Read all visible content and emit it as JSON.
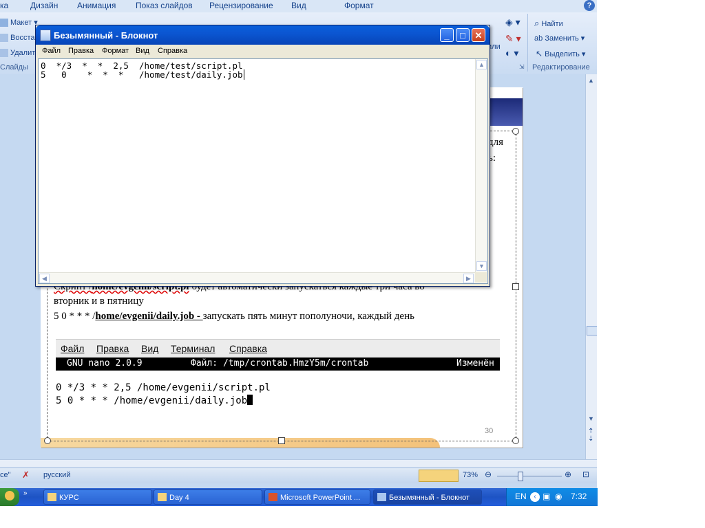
{
  "powerpoint": {
    "ribbon_tabs": [
      "ка",
      "Дизайн",
      "Анимация",
      "Показ слайдов",
      "Рецензирование",
      "Вид",
      "Формат"
    ],
    "slides_group": {
      "maket": "Макет",
      "restore": "Восстан",
      "delete": "Удалит",
      "label": "Слайды"
    },
    "partial_label": "или",
    "editing_group": {
      "find": "Найти",
      "replace": "Заменить",
      "select": "Выделить",
      "label": "Редактирование"
    },
    "slide": {
      "partial_right_1": "для",
      "partial_right_2": "ь:",
      "text_line1_prefix": "Скрипт /",
      "text_line1_bold": "home/evgenii/script.pl",
      "text_line1_rest": " будет автоматически запускаться каждые три часа во",
      "text_line2": "вторник и в пятницу",
      "text_line3_prefix": "5 0 * * * /",
      "text_line3_bold": "home/evgenii/daily.job - ",
      "text_line3_rest": " запускать пять минут пополуночи, каждый день",
      "nano_menu": [
        "Файл",
        "Правка",
        "Вид",
        "Терминал",
        "Справка"
      ],
      "nano_bar": {
        "version": "GNU nano 2.0.9",
        "file": "Файл: /tmp/crontab.HmzY5m/crontab",
        "state": "Изменён"
      },
      "nano_line1": "0 */3 * * 2,5 /home/evgenii/script.pl",
      "nano_line2": "5 0 * * * /home/evgenii/daily.job",
      "slide_number": "30"
    },
    "status": {
      "left": "се\"",
      "lang": "русский",
      "zoom": "73%"
    }
  },
  "notepad": {
    "title": "Безымянный - Блокнот",
    "menu": [
      "Файл",
      "Правка",
      "Формат",
      "Вид",
      "Справка"
    ],
    "lines": [
      "0  */3  *  *  2,5  /home/test/script.pl",
      "5   0    *  *  *   /home/test/daily.job"
    ]
  },
  "taskbar": {
    "tasks": [
      "КУРС",
      "Day 4",
      "Microsoft PowerPoint ...",
      "Безымянный - Блокнот"
    ],
    "lang": "EN",
    "time": "7:32"
  },
  "colors": {
    "titlebar": "#0a5fda",
    "taskbar": "#245edb",
    "slide_band": "#1c2a78"
  }
}
